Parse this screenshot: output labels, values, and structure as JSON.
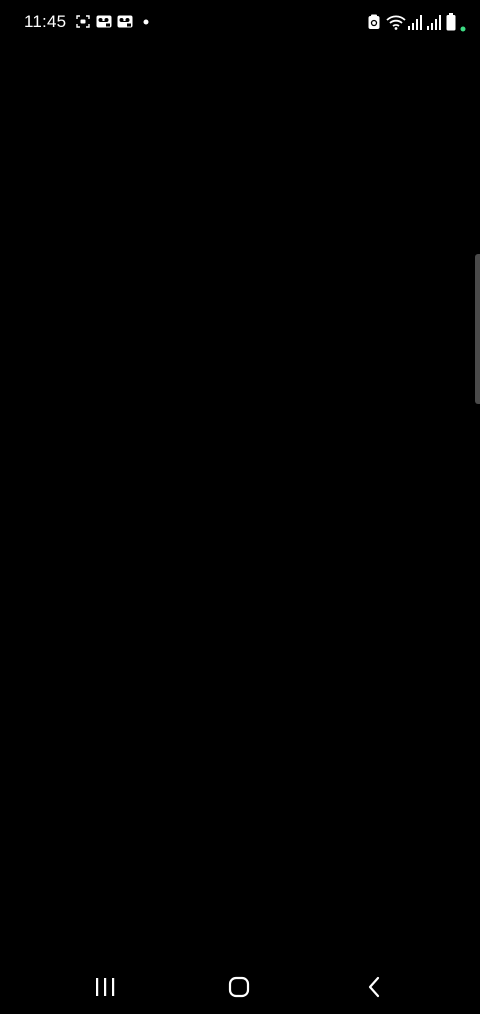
{
  "status_bar": {
    "time": "11:45",
    "left_icons": [
      "screen-record-icon",
      "voicemail-icon",
      "voicemail-icon",
      "notification-dot-icon"
    ],
    "right_icons": [
      "nfc-icon",
      "wifi-icon",
      "signal-sim1-icon",
      "signal-sim2-icon",
      "battery-icon"
    ],
    "battery_indicator_color": "#3ddc84"
  },
  "screen": {
    "background": "#000000"
  },
  "navigation_bar": {
    "buttons": [
      "recent-apps-icon",
      "home-icon",
      "back-icon"
    ]
  }
}
